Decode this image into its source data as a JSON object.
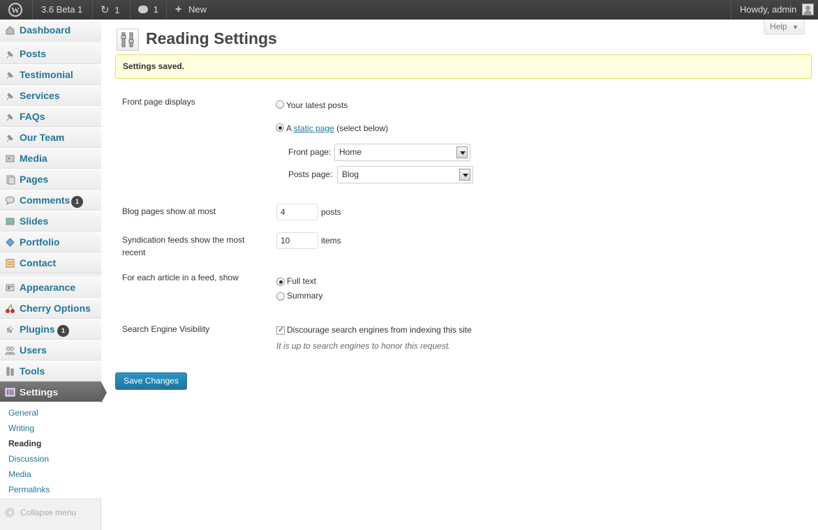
{
  "adminbar": {
    "version": "3.6 Beta 1",
    "updates_count": "1",
    "comments_count": "1",
    "new_label": "New",
    "greeting": "Howdy, admin"
  },
  "sidebar": {
    "items": [
      {
        "label": "Dashboard",
        "icon": "dashboard-icon"
      },
      {
        "label": "Posts",
        "icon": "pin-icon"
      },
      {
        "label": "Testimonial",
        "icon": "pin-icon"
      },
      {
        "label": "Services",
        "icon": "pin-icon"
      },
      {
        "label": "FAQs",
        "icon": "pin-icon"
      },
      {
        "label": "Our Team",
        "icon": "pin-icon"
      },
      {
        "label": "Media",
        "icon": "media-icon"
      },
      {
        "label": "Pages",
        "icon": "pages-icon"
      },
      {
        "label": "Comments",
        "icon": "comments-icon",
        "badge": "1"
      },
      {
        "label": "Slides",
        "icon": "slides-icon"
      },
      {
        "label": "Portfolio",
        "icon": "portfolio-icon"
      },
      {
        "label": "Contact",
        "icon": "contact-icon"
      },
      {
        "label": "Appearance",
        "icon": "appearance-icon"
      },
      {
        "label": "Cherry Options",
        "icon": "cherry-icon"
      },
      {
        "label": "Plugins",
        "icon": "plugins-icon",
        "badge": "1"
      },
      {
        "label": "Users",
        "icon": "users-icon"
      },
      {
        "label": "Tools",
        "icon": "tools-icon"
      },
      {
        "label": "Settings",
        "icon": "settings-icon",
        "current": true
      }
    ],
    "submenu": [
      "General",
      "Writing",
      "Reading",
      "Discussion",
      "Media",
      "Permalinks"
    ],
    "submenu_current": "Reading",
    "collapse_label": "Collapse menu"
  },
  "header": {
    "help_label": "Help",
    "title": "Reading Settings"
  },
  "notice": "Settings saved.",
  "form": {
    "front_page_displays_label": "Front page displays",
    "option_latest_posts": "Your latest posts",
    "option_static_prefix": "A",
    "option_static_link": "static page",
    "option_static_suffix": "(select below)",
    "front_page_label": "Front page:",
    "front_page_value": "Home",
    "posts_page_label": "Posts page:",
    "posts_page_value": "Blog",
    "blog_pages_label": "Blog pages show at most",
    "blog_pages_value": "4",
    "blog_pages_unit": "posts",
    "syndication_label": "Syndication feeds show the most recent",
    "syndication_value": "10",
    "syndication_unit": "items",
    "feed_article_label": "For each article in a feed, show",
    "option_full_text": "Full text",
    "option_summary": "Summary",
    "seo_label": "Search Engine Visibility",
    "seo_checkbox_label": "Discourage search engines from indexing this site",
    "seo_note": "It is up to search engines to honor this request.",
    "save_label": "Save Changes"
  },
  "colors": {
    "link": "#21759b",
    "notice_bg": "#ffffe0",
    "notice_border": "#e6db55",
    "adminbar": "#464646",
    "primary_button": "#21759b"
  }
}
